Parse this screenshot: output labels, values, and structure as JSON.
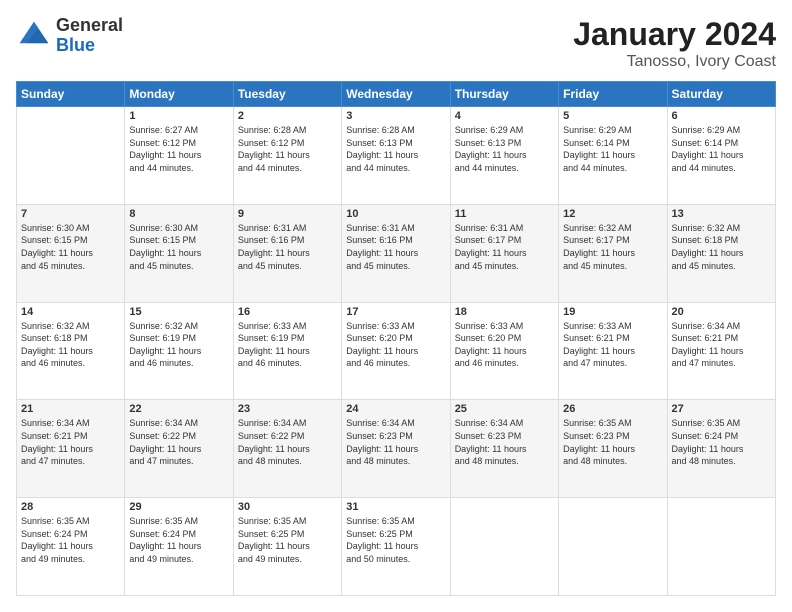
{
  "logo": {
    "general": "General",
    "blue": "Blue"
  },
  "title": "January 2024",
  "location": "Tanosso, Ivory Coast",
  "days_header": [
    "Sunday",
    "Monday",
    "Tuesday",
    "Wednesday",
    "Thursday",
    "Friday",
    "Saturday"
  ],
  "weeks": [
    [
      {
        "day": "",
        "info": ""
      },
      {
        "day": "1",
        "info": "Sunrise: 6:27 AM\nSunset: 6:12 PM\nDaylight: 11 hours\nand 44 minutes."
      },
      {
        "day": "2",
        "info": "Sunrise: 6:28 AM\nSunset: 6:12 PM\nDaylight: 11 hours\nand 44 minutes."
      },
      {
        "day": "3",
        "info": "Sunrise: 6:28 AM\nSunset: 6:13 PM\nDaylight: 11 hours\nand 44 minutes."
      },
      {
        "day": "4",
        "info": "Sunrise: 6:29 AM\nSunset: 6:13 PM\nDaylight: 11 hours\nand 44 minutes."
      },
      {
        "day": "5",
        "info": "Sunrise: 6:29 AM\nSunset: 6:14 PM\nDaylight: 11 hours\nand 44 minutes."
      },
      {
        "day": "6",
        "info": "Sunrise: 6:29 AM\nSunset: 6:14 PM\nDaylight: 11 hours\nand 44 minutes."
      }
    ],
    [
      {
        "day": "7",
        "info": "Sunrise: 6:30 AM\nSunset: 6:15 PM\nDaylight: 11 hours\nand 45 minutes."
      },
      {
        "day": "8",
        "info": "Sunrise: 6:30 AM\nSunset: 6:15 PM\nDaylight: 11 hours\nand 45 minutes."
      },
      {
        "day": "9",
        "info": "Sunrise: 6:31 AM\nSunset: 6:16 PM\nDaylight: 11 hours\nand 45 minutes."
      },
      {
        "day": "10",
        "info": "Sunrise: 6:31 AM\nSunset: 6:16 PM\nDaylight: 11 hours\nand 45 minutes."
      },
      {
        "day": "11",
        "info": "Sunrise: 6:31 AM\nSunset: 6:17 PM\nDaylight: 11 hours\nand 45 minutes."
      },
      {
        "day": "12",
        "info": "Sunrise: 6:32 AM\nSunset: 6:17 PM\nDaylight: 11 hours\nand 45 minutes."
      },
      {
        "day": "13",
        "info": "Sunrise: 6:32 AM\nSunset: 6:18 PM\nDaylight: 11 hours\nand 45 minutes."
      }
    ],
    [
      {
        "day": "14",
        "info": "Sunrise: 6:32 AM\nSunset: 6:18 PM\nDaylight: 11 hours\nand 46 minutes."
      },
      {
        "day": "15",
        "info": "Sunrise: 6:32 AM\nSunset: 6:19 PM\nDaylight: 11 hours\nand 46 minutes."
      },
      {
        "day": "16",
        "info": "Sunrise: 6:33 AM\nSunset: 6:19 PM\nDaylight: 11 hours\nand 46 minutes."
      },
      {
        "day": "17",
        "info": "Sunrise: 6:33 AM\nSunset: 6:20 PM\nDaylight: 11 hours\nand 46 minutes."
      },
      {
        "day": "18",
        "info": "Sunrise: 6:33 AM\nSunset: 6:20 PM\nDaylight: 11 hours\nand 46 minutes."
      },
      {
        "day": "19",
        "info": "Sunrise: 6:33 AM\nSunset: 6:21 PM\nDaylight: 11 hours\nand 47 minutes."
      },
      {
        "day": "20",
        "info": "Sunrise: 6:34 AM\nSunset: 6:21 PM\nDaylight: 11 hours\nand 47 minutes."
      }
    ],
    [
      {
        "day": "21",
        "info": "Sunrise: 6:34 AM\nSunset: 6:21 PM\nDaylight: 11 hours\nand 47 minutes."
      },
      {
        "day": "22",
        "info": "Sunrise: 6:34 AM\nSunset: 6:22 PM\nDaylight: 11 hours\nand 47 minutes."
      },
      {
        "day": "23",
        "info": "Sunrise: 6:34 AM\nSunset: 6:22 PM\nDaylight: 11 hours\nand 48 minutes."
      },
      {
        "day": "24",
        "info": "Sunrise: 6:34 AM\nSunset: 6:23 PM\nDaylight: 11 hours\nand 48 minutes."
      },
      {
        "day": "25",
        "info": "Sunrise: 6:34 AM\nSunset: 6:23 PM\nDaylight: 11 hours\nand 48 minutes."
      },
      {
        "day": "26",
        "info": "Sunrise: 6:35 AM\nSunset: 6:23 PM\nDaylight: 11 hours\nand 48 minutes."
      },
      {
        "day": "27",
        "info": "Sunrise: 6:35 AM\nSunset: 6:24 PM\nDaylight: 11 hours\nand 48 minutes."
      }
    ],
    [
      {
        "day": "28",
        "info": "Sunrise: 6:35 AM\nSunset: 6:24 PM\nDaylight: 11 hours\nand 49 minutes."
      },
      {
        "day": "29",
        "info": "Sunrise: 6:35 AM\nSunset: 6:24 PM\nDaylight: 11 hours\nand 49 minutes."
      },
      {
        "day": "30",
        "info": "Sunrise: 6:35 AM\nSunset: 6:25 PM\nDaylight: 11 hours\nand 49 minutes."
      },
      {
        "day": "31",
        "info": "Sunrise: 6:35 AM\nSunset: 6:25 PM\nDaylight: 11 hours\nand 50 minutes."
      },
      {
        "day": "",
        "info": ""
      },
      {
        "day": "",
        "info": ""
      },
      {
        "day": "",
        "info": ""
      }
    ]
  ]
}
